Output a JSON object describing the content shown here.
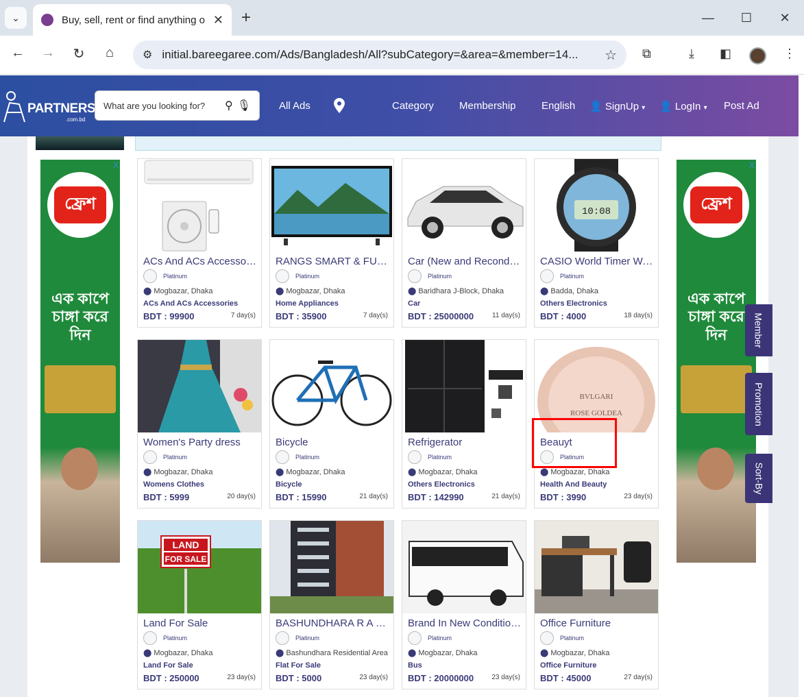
{
  "browser": {
    "tab_title": "Buy, sell, rent or find anything o",
    "url": "initial.bareegaree.com/Ads/Bangladesh/All?subCategory=&area=&member=14..."
  },
  "header": {
    "logo_text": "PARTNERS",
    "logo_sub": ".com.bd",
    "search_placeholder": "What are you looking for?",
    "nav": {
      "all_ads": "All Ads",
      "category": "Category",
      "membership": "Membership",
      "language": "English",
      "signup": "SignUp",
      "login": "LogIn",
      "post_ad": "Post Ad"
    }
  },
  "ads": {
    "close": "X",
    "brand": "ফ্রেশ",
    "tagline": "এক কাপে চাঙ্গা করে দিন"
  },
  "side_tabs": {
    "member": "Member",
    "promotion": "Promotion",
    "sort_by": "Sort-By"
  },
  "listings": [
    {
      "title": "ACs And ACs Accessories",
      "member": "Platinum",
      "location": "Mogbazar, Dhaka",
      "category": "ACs And ACs Accessories",
      "price": "BDT : 99900",
      "age": "7 day(s)",
      "image": "ac-unit"
    },
    {
      "title": "RANGS SMART & FULL HD TV",
      "member": "Platinum",
      "location": "Mogbazar, Dhaka",
      "category": "Home Appliances",
      "price": "BDT : 35900",
      "age": "7 day(s)",
      "image": "tv"
    },
    {
      "title": "Car (New and Reconditioned)",
      "member": "Platinum",
      "location": "Baridhara J-Block, Dhaka",
      "category": "Car",
      "price": "BDT : 25000000",
      "age": "11 day(s)",
      "image": "car"
    },
    {
      "title": "CASIO World Timer Watch",
      "member": "Platinum",
      "location": "Badda, Dhaka",
      "category": "Others Electronics",
      "price": "BDT : 4000",
      "age": "18 day(s)",
      "image": "watch"
    },
    {
      "title": "Women's Party dress",
      "member": "Platinum",
      "location": "Mogbazar, Dhaka",
      "category": "Womens Clothes",
      "price": "BDT : 5999",
      "age": "20 day(s)",
      "image": "dress"
    },
    {
      "title": "Bicycle",
      "member": "Platinum",
      "location": "Mogbazar, Dhaka",
      "category": "Bicycle",
      "price": "BDT : 15990",
      "age": "21 day(s)",
      "image": "bicycle"
    },
    {
      "title": "Refrigerator",
      "member": "Platinum",
      "location": "Mogbazar, Dhaka",
      "category": "Others Electronics",
      "price": "BDT : 142990",
      "age": "21 day(s)",
      "image": "fridge"
    },
    {
      "title": "Beauyt",
      "member": "Platinum",
      "location": "Mogbazar, Dhaka",
      "category": "Health And Beauty",
      "price": "BDT : 3990",
      "age": "23 day(s)",
      "image": "perfume"
    },
    {
      "title": "Land For Sale",
      "member": "Platinum",
      "location": "Mogbazar, Dhaka",
      "category": "Land For Sale",
      "price": "BDT : 250000",
      "age": "23 day(s)",
      "image": "land"
    },
    {
      "title": "BASHUNDHARA R A Flat",
      "member": "Platinum",
      "location": "Bashundhara Residential Area",
      "category": "Flat For Sale",
      "price": "BDT : 5000",
      "age": "23 day(s)",
      "image": "building"
    },
    {
      "title": "Brand In New Condition Bus",
      "member": "Platinum",
      "location": "Mogbazar, Dhaka",
      "category": "Bus",
      "price": "BDT : 20000000",
      "age": "23 day(s)",
      "image": "bus"
    },
    {
      "title": "Office Furniture",
      "member": "Platinum",
      "location": "Mogbazar, Dhaka",
      "category": "Office Furniture",
      "price": "BDT : 45000",
      "age": "27 day(s)",
      "image": "desk"
    }
  ],
  "image_text": {
    "land_sign_1": "LAND",
    "land_sign_2": "FOR SALE",
    "perfume_1": "BVLGARI",
    "perfume_2": "ROSE GOLDEA"
  }
}
